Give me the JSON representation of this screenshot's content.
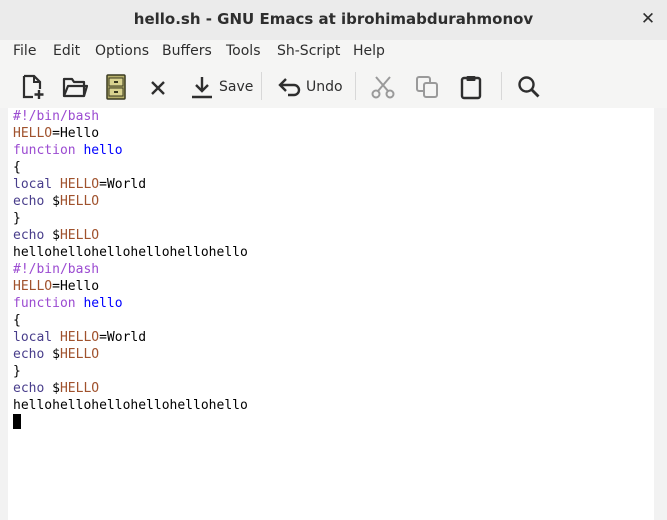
{
  "window": {
    "title": "hello.sh - GNU Emacs at ibrohimabdurahmonov",
    "close_glyph": "✕"
  },
  "menu": [
    "File",
    "Edit",
    "Options",
    "Buffers",
    "Tools",
    "Sh-Script",
    "Help"
  ],
  "toolbar": {
    "save_label": "Save",
    "undo_label": "Undo"
  },
  "colors": {
    "comment": "#b22caa",
    "keyword": "#9b4bd1",
    "variable": "#a0522d",
    "function_name": "#0000ff",
    "builtin": "#483d8b",
    "plain": "#000000"
  },
  "editor": {
    "lines": [
      [
        {
          "t": "#!/bin/bash",
          "c": "keyword"
        }
      ],
      [
        {
          "t": "HELLO",
          "c": "variable"
        },
        {
          "t": "=Hello",
          "c": "plain"
        }
      ],
      [
        {
          "t": "function",
          "c": "keyword"
        },
        {
          "t": " ",
          "c": "plain"
        },
        {
          "t": "hello",
          "c": "function_name"
        }
      ],
      [
        {
          "t": "{",
          "c": "plain"
        }
      ],
      [
        {
          "t": "local",
          "c": "builtin"
        },
        {
          "t": " ",
          "c": "plain"
        },
        {
          "t": "HELLO",
          "c": "variable"
        },
        {
          "t": "=World",
          "c": "plain"
        }
      ],
      [
        {
          "t": "echo",
          "c": "builtin"
        },
        {
          "t": " $",
          "c": "plain"
        },
        {
          "t": "HELLO",
          "c": "variable"
        }
      ],
      [
        {
          "t": "}",
          "c": "plain"
        }
      ],
      [
        {
          "t": "echo",
          "c": "builtin"
        },
        {
          "t": " $",
          "c": "plain"
        },
        {
          "t": "HELLO",
          "c": "variable"
        }
      ],
      [
        {
          "t": "hellohellohellohellohellohello",
          "c": "plain"
        }
      ],
      [
        {
          "t": "#!/bin/bash",
          "c": "keyword"
        }
      ],
      [
        {
          "t": "HELLO",
          "c": "variable"
        },
        {
          "t": "=Hello",
          "c": "plain"
        }
      ],
      [
        {
          "t": "function",
          "c": "keyword"
        },
        {
          "t": " ",
          "c": "plain"
        },
        {
          "t": "hello",
          "c": "function_name"
        }
      ],
      [
        {
          "t": "{",
          "c": "plain"
        }
      ],
      [
        {
          "t": "local",
          "c": "builtin"
        },
        {
          "t": " ",
          "c": "plain"
        },
        {
          "t": "HELLO",
          "c": "variable"
        },
        {
          "t": "=World",
          "c": "plain"
        }
      ],
      [
        {
          "t": "echo",
          "c": "builtin"
        },
        {
          "t": " $",
          "c": "plain"
        },
        {
          "t": "HELLO",
          "c": "variable"
        }
      ],
      [
        {
          "t": "}",
          "c": "plain"
        }
      ],
      [
        {
          "t": "echo",
          "c": "builtin"
        },
        {
          "t": " $",
          "c": "plain"
        },
        {
          "t": "HELLO",
          "c": "variable"
        }
      ],
      [
        {
          "t": "hellohellohellohellohellohello",
          "c": "plain"
        }
      ]
    ]
  }
}
